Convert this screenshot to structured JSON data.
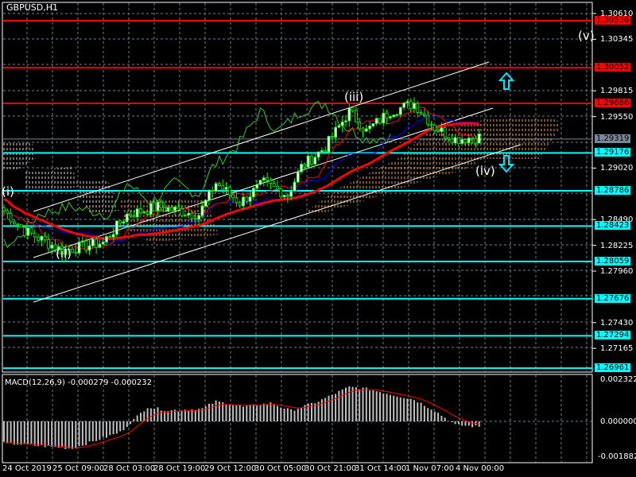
{
  "window": {
    "title": "GBPUSD,H1"
  },
  "macd_label": "MACD(12,26,9) -0.000279 -0.000232",
  "colors": {
    "background": "#000000",
    "grid": "#6f7f8f",
    "bull": "#00ff00",
    "resistance": "#ff0000",
    "support": "#00ffff",
    "current": "#778899",
    "cloud": "#f4a460",
    "kijun": "#0000ff",
    "ma": "#ff0000"
  },
  "price_axis": {
    "ticks": [
      "1.30610",
      "1.30345",
      "1.29815",
      "1.29550",
      "1.29020",
      "1.28490",
      "1.28225",
      "1.27960",
      "1.27430",
      "1.27165"
    ]
  },
  "levels": [
    {
      "price": "1.30536",
      "kind": "resistance"
    },
    {
      "price": "1.30052",
      "kind": "resistance"
    },
    {
      "price": "1.29686",
      "kind": "resistance"
    },
    {
      "price": "1.29319",
      "kind": "current"
    },
    {
      "price": "1.29176",
      "kind": "support"
    },
    {
      "price": "1.28786",
      "kind": "support"
    },
    {
      "price": "1.28423",
      "kind": "support"
    },
    {
      "price": "1.28059",
      "kind": "support"
    },
    {
      "price": "1.27676",
      "kind": "support"
    },
    {
      "price": "1.27294",
      "kind": "support"
    },
    {
      "price": "1.26961",
      "kind": "support"
    }
  ],
  "macd_axis": {
    "ticks": [
      "0.002322",
      "0.000000",
      "-0.001882"
    ]
  },
  "time_axis": {
    "labels": [
      "24 Oct 2019",
      "25 Oct 09:00",
      "28 Oct 03:00",
      "28 Oct 19:00",
      "29 Oct 12:00",
      "30 Oct 05:00",
      "30 Oct 21:00",
      "31 Oct 14:00",
      "1 Nov 07:00",
      "4 Nov 00:00"
    ]
  },
  "waves": {
    "i": "(i)",
    "ii": "(ii)",
    "iii": "(iii)",
    "iv": "(iv)",
    "v": "(v)"
  },
  "chart_data": {
    "type": "candlestick",
    "symbol": "GBPUSD",
    "timeframe": "H1",
    "ylim": [
      1.2688,
      1.3072
    ],
    "bars": 140,
    "close_anchors": [
      [
        0,
        1.28582
      ],
      [
        6,
        1.28377
      ],
      [
        17,
        1.28173
      ],
      [
        29,
        1.28254
      ],
      [
        36,
        1.28541
      ],
      [
        45,
        1.28622
      ],
      [
        57,
        1.28541
      ],
      [
        62,
        1.28868
      ],
      [
        69,
        1.28663
      ],
      [
        76,
        1.28868
      ],
      [
        83,
        1.28745
      ],
      [
        87,
        1.29031
      ],
      [
        94,
        1.29236
      ],
      [
        101,
        1.29604
      ],
      [
        106,
        1.294
      ],
      [
        113,
        1.29604
      ],
      [
        120,
        1.29686
      ],
      [
        126,
        1.2944
      ],
      [
        132,
        1.29318
      ],
      [
        139,
        1.2934
      ]
    ],
    "macd_ylim": [
      -0.001882,
      0.002322
    ],
    "macd_hist_anchors": [
      [
        0,
        -0.0012
      ],
      [
        20,
        -0.0015
      ],
      [
        34,
        -0.0006
      ],
      [
        42,
        0.0008
      ],
      [
        48,
        0.0006
      ],
      [
        58,
        0.0007
      ],
      [
        62,
        0.0011
      ],
      [
        70,
        0.0008
      ],
      [
        78,
        0.001
      ],
      [
        84,
        0.0006
      ],
      [
        92,
        0.0011
      ],
      [
        101,
        0.0019
      ],
      [
        106,
        0.0018
      ],
      [
        113,
        0.0015
      ],
      [
        120,
        0.0012
      ],
      [
        126,
        0.0006
      ],
      [
        132,
        -0.0002
      ],
      [
        139,
        -0.0003
      ]
    ],
    "buy_arrow_price": 1.2986,
    "sell_arrow_price": 1.2905
  }
}
